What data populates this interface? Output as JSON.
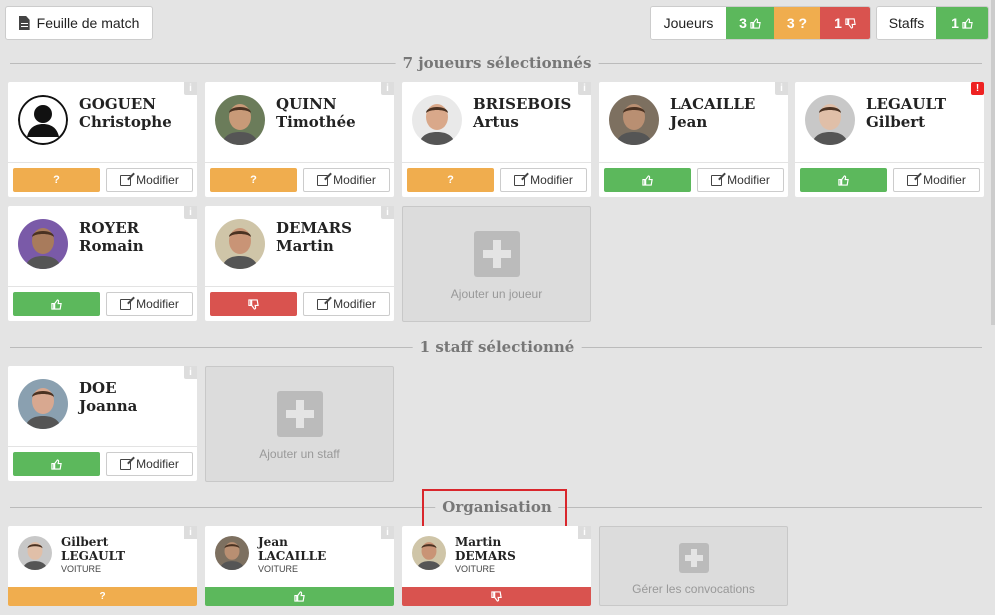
{
  "toolbar": {
    "match_sheet_label": "Feuille de match",
    "players_label": "Joueurs",
    "players_yes": "3",
    "players_maybe": "3 ?",
    "players_no": "1",
    "staffs_label": "Staffs",
    "staffs_yes": "1"
  },
  "sections": {
    "players_title": "7 joueurs sélectionnés",
    "staff_title": "1 staff sélectionné",
    "org_title": "Organisation"
  },
  "players": [
    {
      "first": "GOGUEN",
      "last": "Christophe",
      "status": "?"
    },
    {
      "first": "QUINN",
      "last": "Timothée",
      "status": "?"
    },
    {
      "first": "BRISEBOIS",
      "last": "Artus",
      "status": "?"
    },
    {
      "first": "LACAILLE",
      "last": "Jean",
      "status": ""
    },
    {
      "first": "LEGAULT",
      "last": "Gilbert",
      "status": ""
    },
    {
      "first": "ROYER",
      "last": "Romain",
      "status": ""
    },
    {
      "first": "DEMARS",
      "last": "Martin",
      "status": ""
    }
  ],
  "staff": [
    {
      "first": "DOE",
      "last": "Joanna",
      "status": ""
    }
  ],
  "organisation": [
    {
      "first": "Gilbert",
      "last": "LEGAULT",
      "role": "VOITURE",
      "status": "?"
    },
    {
      "first": "Jean",
      "last": "LACAILLE",
      "role": "VOITURE",
      "status": ""
    },
    {
      "first": "Martin",
      "last": "DEMARS",
      "role": "VOITURE",
      "status": ""
    }
  ],
  "labels": {
    "modify": "Modifier",
    "add_player": "Ajouter un joueur",
    "add_staff": "Ajouter un staff",
    "manage": "Gérer les convocations",
    "info": "i",
    "alert": "!"
  },
  "colors": {
    "green": "#5cb85c",
    "orange": "#f0ad4e",
    "red": "#d9534f"
  }
}
